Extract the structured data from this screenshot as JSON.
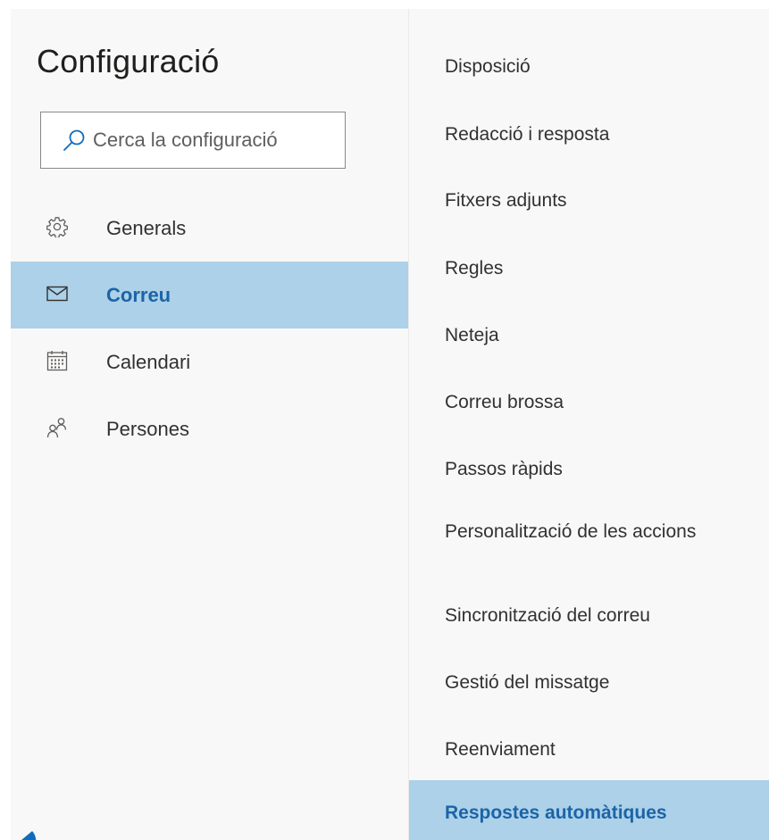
{
  "settings": {
    "title": "Configuració",
    "search": {
      "placeholder": "Cerca la configuració",
      "value": ""
    },
    "nav": [
      {
        "label": "Generals",
        "icon": "gear-icon",
        "selected": false
      },
      {
        "label": "Correu",
        "icon": "mail-icon",
        "selected": true
      },
      {
        "label": "Calendari",
        "icon": "calendar-icon",
        "selected": false
      },
      {
        "label": "Persones",
        "icon": "people-icon",
        "selected": false
      }
    ],
    "subnav": [
      {
        "label": "Disposició",
        "selected": false
      },
      {
        "label": "Redacció i resposta",
        "selected": false
      },
      {
        "label": "Fitxers adjunts",
        "selected": false
      },
      {
        "label": "Regles",
        "selected": false
      },
      {
        "label": "Neteja",
        "selected": false
      },
      {
        "label": "Correu brossa",
        "selected": false
      },
      {
        "label": "Passos ràpids",
        "selected": false
      },
      {
        "label": "Personalització de les accions",
        "selected": false
      },
      {
        "label": "Sincronització del correu",
        "selected": false
      },
      {
        "label": "Gestió del missatge",
        "selected": false
      },
      {
        "label": "Reenviament",
        "selected": false
      },
      {
        "label": "Respostes automàtiques",
        "selected": true
      }
    ]
  },
  "colors": {
    "selected_bg": "#acd1e8",
    "selected_text": "#1c64a8",
    "pane_bg": "#f8f8f8",
    "text": "#323130"
  }
}
